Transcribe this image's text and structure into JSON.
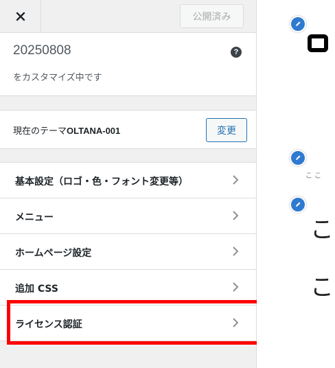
{
  "header": {
    "close_icon": "close-icon",
    "publish_label": "公開済み"
  },
  "info": {
    "title": "20250808",
    "subtitle": "をカスタマイズ中です",
    "help_glyph": "?"
  },
  "theme": {
    "prefix": "現在のテーマ",
    "name": "OLTANA-001",
    "change_label": "変更"
  },
  "menu": {
    "items": [
      {
        "label": "基本設定（ロゴ・色・フォント変更等）"
      },
      {
        "label": "メニュー"
      },
      {
        "label": "ホームページ設定"
      },
      {
        "label": "追加 CSS"
      },
      {
        "label": "ライセンス認証"
      }
    ]
  },
  "preview": {
    "small_text": "ここ",
    "big1": "こ",
    "big2": "こ"
  },
  "colors": {
    "accent": "#2271b1",
    "highlight": "#ff0000",
    "edit_badge": "#2f7ad1"
  }
}
